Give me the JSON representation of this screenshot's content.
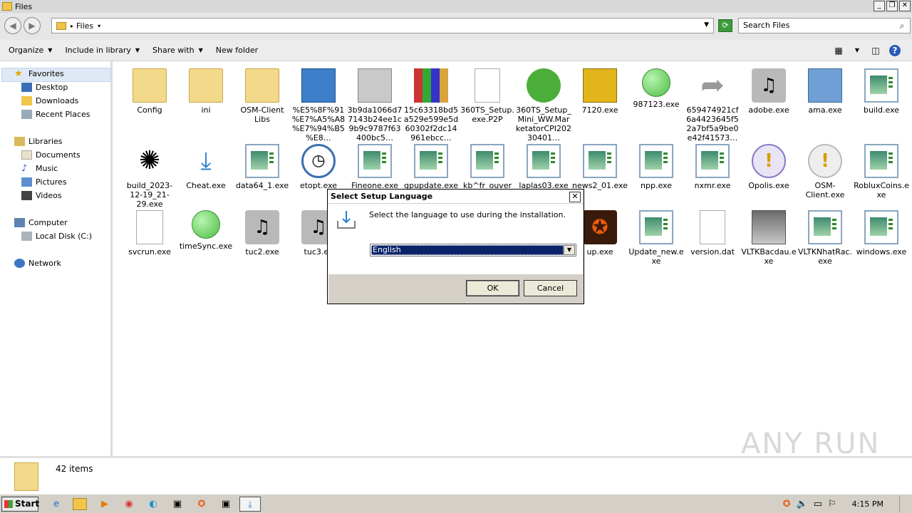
{
  "window": {
    "title": "Files",
    "min": "_",
    "max": "❐",
    "close": "✕"
  },
  "address": {
    "path": "Files",
    "search_placeholder": "Search Files"
  },
  "toolbar": {
    "organize": "Organize",
    "include": "Include in library",
    "share": "Share with",
    "new_folder": "New folder"
  },
  "nav": {
    "favorites": "Favorites",
    "desktop": "Desktop",
    "downloads": "Downloads",
    "recent": "Recent Places",
    "libraries": "Libraries",
    "documents": "Documents",
    "music": "Music",
    "pictures": "Pictures",
    "videos": "Videos",
    "computer": "Computer",
    "localdisk": "Local Disk (C:)",
    "network": "Network"
  },
  "files": [
    {
      "name": "Config"
    },
    {
      "name": "ini"
    },
    {
      "name": "OSM-Client Libs"
    },
    {
      "name": "%E5%8F%91%E7%A5%A8%E7%94%B5%E8…"
    },
    {
      "name": "3b9da1066d77143b24ee1c9b9c9787f63400bc5…"
    },
    {
      "name": "15c63318bd5a529e599e5d60302f2dc14961ebcc…"
    },
    {
      "name": "360TS_Setup.exe.P2P"
    },
    {
      "name": "360TS_Setup_Mini_WW.MarketatorCPI20230401…"
    },
    {
      "name": "7120.exe"
    },
    {
      "name": "987123.exe"
    },
    {
      "name": "659474921cf6a4423645f52a7bf5a9be0e42f41573…"
    },
    {
      "name": "adobe.exe"
    },
    {
      "name": "ama.exe"
    },
    {
      "name": "build.exe"
    },
    {
      "name": "build_2023-12-19_21-29.exe"
    },
    {
      "name": "Cheat.exe"
    },
    {
      "name": "data64_1.exe"
    },
    {
      "name": "etopt.exe"
    },
    {
      "name": "Fineone.exe"
    },
    {
      "name": "gpupdate.exe"
    },
    {
      "name": "kb^fr_ouver"
    },
    {
      "name": "laplas03.exe"
    },
    {
      "name": "news2_01.exe"
    },
    {
      "name": "npp.exe"
    },
    {
      "name": "nxmr.exe"
    },
    {
      "name": "Opolis.exe"
    },
    {
      "name": "OSM-Client.exe"
    },
    {
      "name": "RobluxCoins.exe"
    },
    {
      "name": "svcrun.exe"
    },
    {
      "name": "timeSync.exe"
    },
    {
      "name": "tuc2.exe"
    },
    {
      "name": "tuc3.ex"
    },
    {
      "name": "up.exe"
    },
    {
      "name": "Update_new.exe"
    },
    {
      "name": "version.dat"
    },
    {
      "name": "VLTKBacdau.exe"
    },
    {
      "name": "VLTKNhatRac.exe"
    },
    {
      "name": "windows.exe"
    }
  ],
  "status": {
    "count": "42 items"
  },
  "dialog": {
    "title": "Select Setup Language",
    "message": "Select the language to use during the installation.",
    "selected_language": "English",
    "ok": "OK",
    "cancel": "Cancel"
  },
  "taskbar": {
    "start": "Start",
    "clock": "4:15 PM"
  },
  "watermark": "ANY RUN"
}
